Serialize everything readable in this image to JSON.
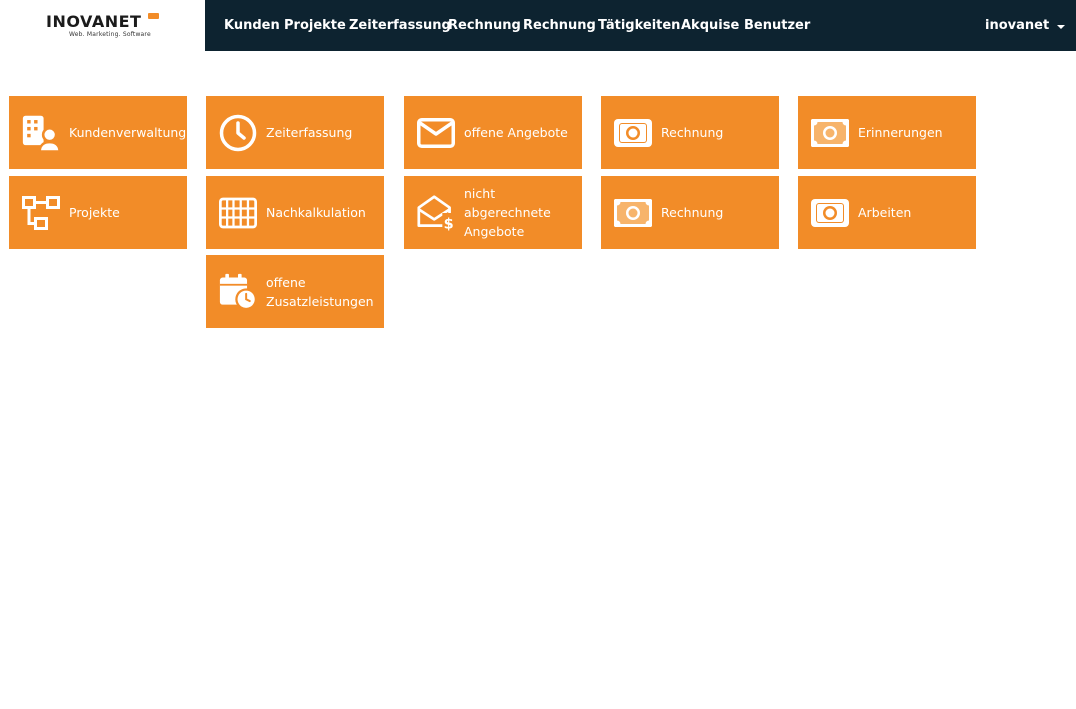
{
  "brand": {
    "name": "INOVANET",
    "tagline": "Web. Marketing. Software"
  },
  "nav": {
    "items": [
      {
        "label": "Kunden"
      },
      {
        "label": "Projekte"
      },
      {
        "label": "Zeiterfassung"
      },
      {
        "label": "Rechnung"
      },
      {
        "label": "Rechnung"
      },
      {
        "label": "Tätigkeiten"
      },
      {
        "label": "Akquise"
      },
      {
        "label": "Benutzer"
      }
    ],
    "user": "inovanet"
  },
  "colors": {
    "tile": "#f28c28",
    "navbar": "#0d2330"
  },
  "tiles": [
    {
      "label": "Kundenverwaltung",
      "icon": "building-user-icon"
    },
    {
      "label": "Projekte",
      "icon": "project-tree-icon"
    },
    {
      "label": "Zeiterfassung",
      "icon": "clock-icon"
    },
    {
      "label": "Nachkalkulation",
      "icon": "abacus-icon"
    },
    {
      "label": "offene Zusatzleistungen",
      "icon": "calendar-clock-icon"
    },
    {
      "label": "offene Angebote",
      "icon": "envelope-icon"
    },
    {
      "label": "nicht abgerechnete Angebote",
      "icon": "envelope-open-dollar-icon"
    },
    {
      "label": "Rechnung",
      "icon": "money-bill-icon"
    },
    {
      "label": "Rechnung",
      "icon": "money-bill-wave-icon"
    },
    {
      "label": "Erinnerungen",
      "icon": "money-bill-wave-icon"
    },
    {
      "label": "Arbeiten",
      "icon": "money-bill-icon"
    }
  ]
}
